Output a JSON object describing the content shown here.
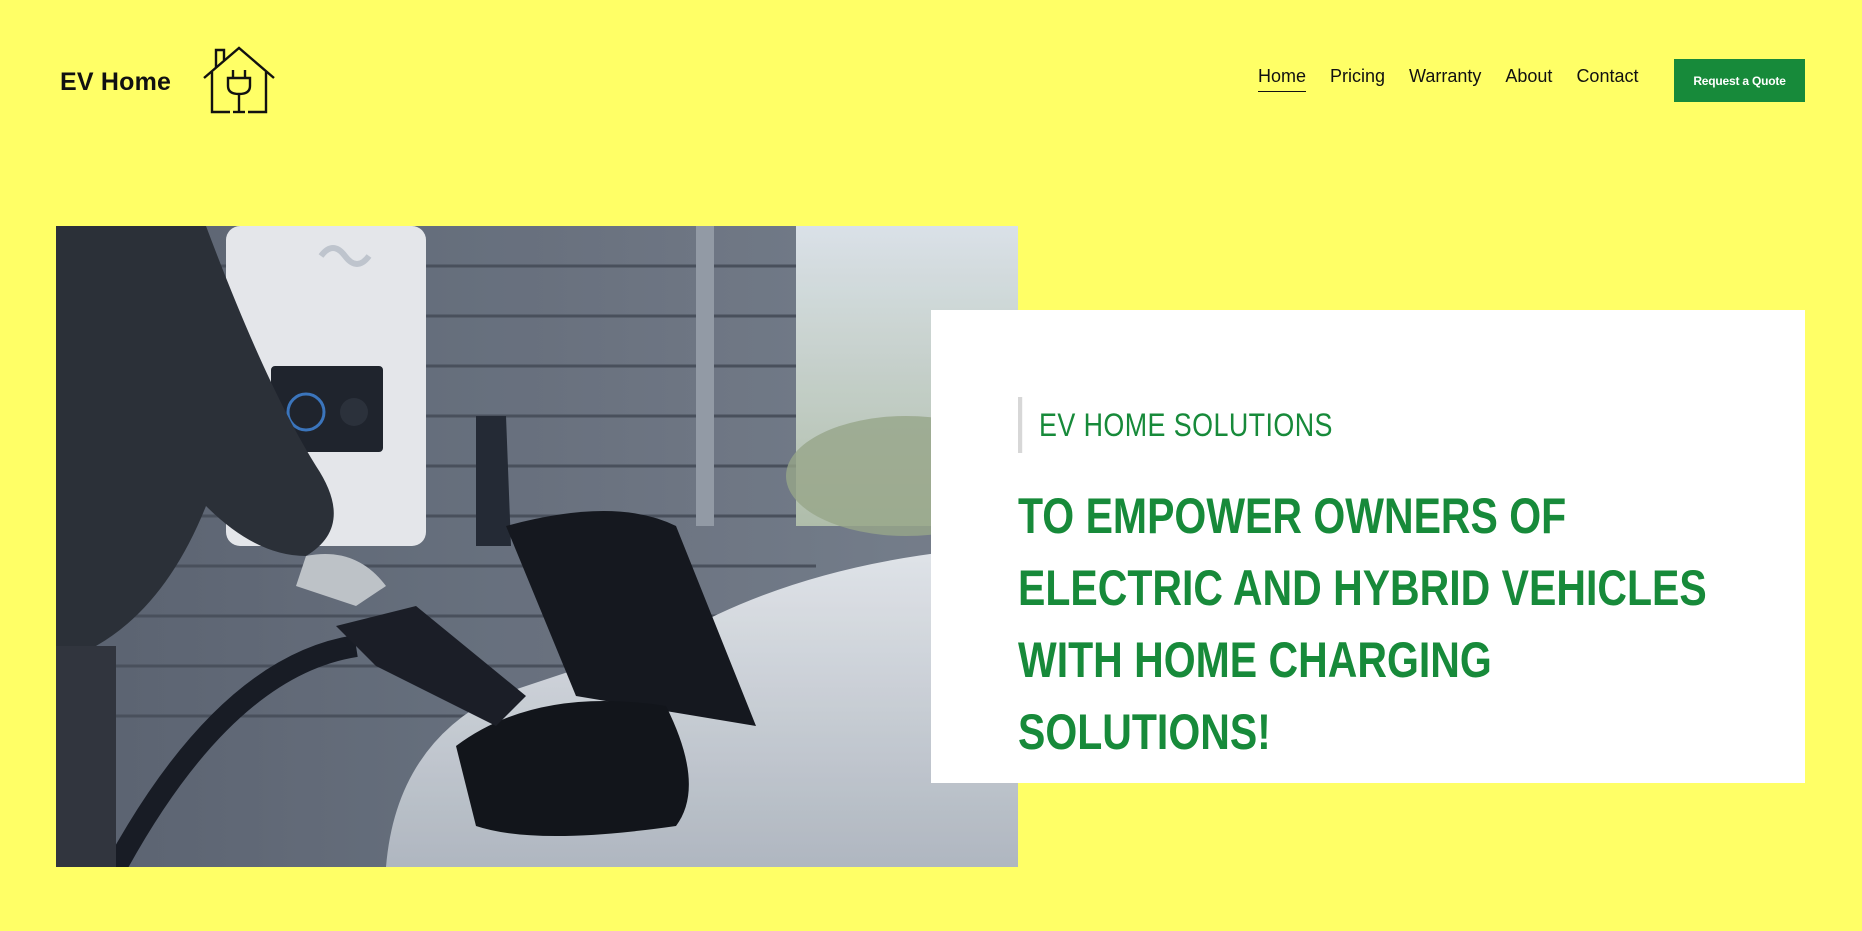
{
  "brand": {
    "name": "EV Home",
    "logo_icon": "house-plug-icon"
  },
  "nav": {
    "items": [
      {
        "label": "Home",
        "active": true
      },
      {
        "label": "Pricing",
        "active": false
      },
      {
        "label": "Warranty",
        "active": false
      },
      {
        "label": "About",
        "active": false
      },
      {
        "label": "Contact",
        "active": false
      }
    ],
    "cta_label": "Request a Quote"
  },
  "hero": {
    "eyebrow": "EV HOME SOLUTIONS",
    "headline": "TO EMPOWER OWNERS OF ELECTRIC AND HYBRID VEHICLES WITH HOME CHARGING SOLUTIONS!"
  },
  "colors": {
    "background": "#ffff66",
    "accent": "#178a3a",
    "card": "#ffffff"
  }
}
